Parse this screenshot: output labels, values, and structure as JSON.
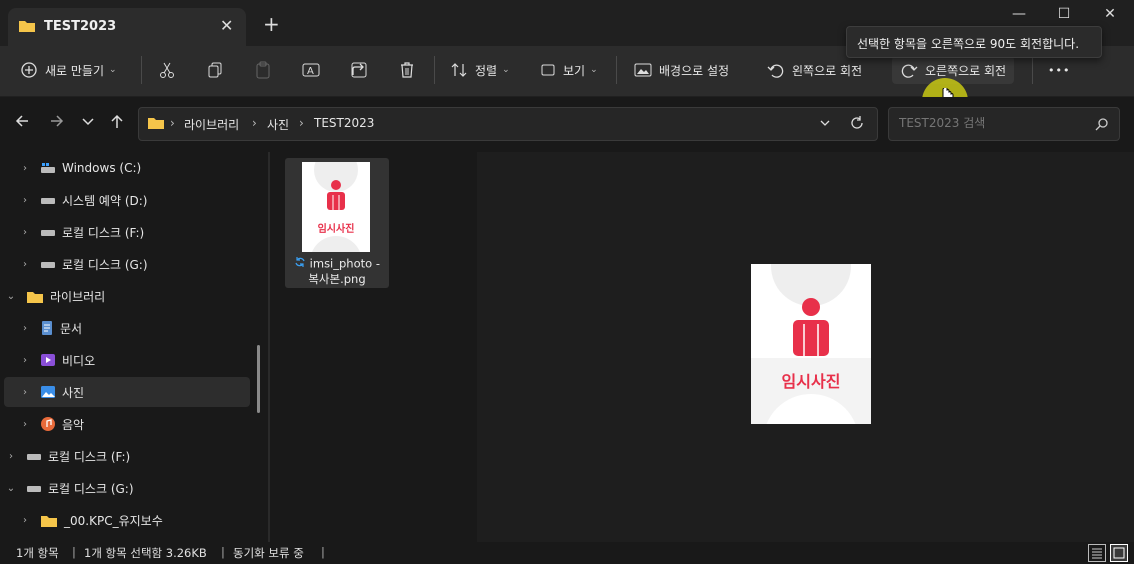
{
  "window": {
    "tab_title": "TEST2023",
    "tab_close": "✕",
    "new_tab": "+",
    "minimize": "—",
    "maximize": "☐",
    "close": "✕"
  },
  "tooltip": "선택한 항목을 오른쪽으로 90도 회전합니다.",
  "toolbar": {
    "new_label": "새로 만들기",
    "sort_label": "정렬",
    "view_label": "보기",
    "set_background_label": "배경으로 설정",
    "rotate_left_label": "왼쪽으로 회전",
    "rotate_right_label": "오른쪽으로 회전",
    "more_label": "•••"
  },
  "address": {
    "crumbs": [
      "라이브러리",
      "사진",
      "TEST2023"
    ],
    "separator": "›",
    "search_placeholder": "TEST2023 검색"
  },
  "sidebar": {
    "items": [
      {
        "label": "Windows (C:)"
      },
      {
        "label": "시스템 예약 (D:)"
      },
      {
        "label": "로컬 디스크 (F:)"
      },
      {
        "label": "로컬 디스크 (G:)"
      },
      {
        "label": "라이브러리"
      },
      {
        "label": "문서"
      },
      {
        "label": "비디오"
      },
      {
        "label": "사진"
      },
      {
        "label": "음악"
      },
      {
        "label": "로컬 디스크 (F:)"
      },
      {
        "label": "로컬 디스크 (G:)"
      },
      {
        "label": "_00.KPC_유지보수"
      }
    ]
  },
  "file": {
    "name_line1": "imsi_photo -",
    "name_line2": "복사본.png",
    "thumb_text": "임시사진"
  },
  "preview": {
    "text": "임시사진"
  },
  "status": {
    "count": "1개 항목",
    "selected": "1개 항목 선택함 3.26KB",
    "sync": "동기화 보류 중",
    "sep": "|"
  },
  "colors": {
    "accent_red": "#e8304a",
    "folder_yellow": "#f5c54a",
    "cursor_highlight": "#c8c814"
  }
}
